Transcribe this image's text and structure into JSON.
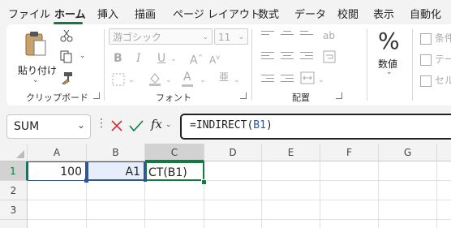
{
  "tabs": [
    "ファイル",
    "ホーム",
    "挿入",
    "描画",
    "ページ レイアウト",
    "数式",
    "データ",
    "校閲",
    "表示",
    "自動化"
  ],
  "clipboard": {
    "paste_label": "貼り付け",
    "group_label": "クリップボード"
  },
  "font": {
    "font_name": "游ゴシック",
    "font_size": "11",
    "bold": "B",
    "italic": "I",
    "underline": "U",
    "group_label": "フォント"
  },
  "alignment": {
    "group_label": "配置"
  },
  "number": {
    "label": "数値",
    "glyph": "%"
  },
  "styles": {
    "items": [
      "条件",
      "テー",
      "セル"
    ]
  },
  "namebox": {
    "value": "SUM"
  },
  "formula": {
    "fx": "fx",
    "prefix": "=INDIRECT(",
    "ref": "B1",
    "suffix": ")"
  },
  "grid": {
    "columns": [
      "A",
      "B",
      "C",
      "D",
      "E",
      "F",
      "G"
    ],
    "rows": [
      "1",
      "2",
      "3"
    ],
    "cells": {
      "A1": "100",
      "B1": "A1",
      "C1": "CT(B1)"
    }
  },
  "colors": {
    "accent": "#107c41",
    "ref_blue": "#2f5597",
    "ref_fill": "#e7eefb",
    "cancel": "#d13438"
  }
}
